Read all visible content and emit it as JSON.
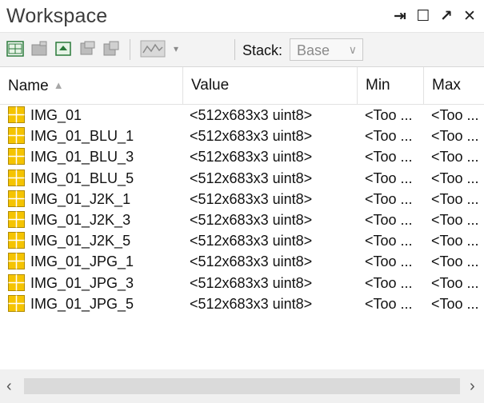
{
  "window": {
    "title": "Workspace",
    "controls": {
      "pin": "⇥",
      "maximize": "☐",
      "undock": "↗",
      "close": "✕"
    }
  },
  "toolbar": {
    "stack_label": "Stack:",
    "stack_value": "Base",
    "dropdown_arrow": "▾",
    "select_arrow": "∨"
  },
  "columns": {
    "name": "Name",
    "value": "Value",
    "min": "Min",
    "max": "Max",
    "sort_indicator": "▲"
  },
  "variables": [
    {
      "name": "IMG_01",
      "value": "<512x683x3 uint8>",
      "min": "<Too ...",
      "max": "<Too ..."
    },
    {
      "name": "IMG_01_BLU_1",
      "value": "<512x683x3 uint8>",
      "min": "<Too ...",
      "max": "<Too ..."
    },
    {
      "name": "IMG_01_BLU_3",
      "value": "<512x683x3 uint8>",
      "min": "<Too ...",
      "max": "<Too ..."
    },
    {
      "name": "IMG_01_BLU_5",
      "value": "<512x683x3 uint8>",
      "min": "<Too ...",
      "max": "<Too ..."
    },
    {
      "name": "IMG_01_J2K_1",
      "value": "<512x683x3 uint8>",
      "min": "<Too ...",
      "max": "<Too ..."
    },
    {
      "name": "IMG_01_J2K_3",
      "value": "<512x683x3 uint8>",
      "min": "<Too ...",
      "max": "<Too ..."
    },
    {
      "name": "IMG_01_J2K_5",
      "value": "<512x683x3 uint8>",
      "min": "<Too ...",
      "max": "<Too ..."
    },
    {
      "name": "IMG_01_JPG_1",
      "value": "<512x683x3 uint8>",
      "min": "<Too ...",
      "max": "<Too ..."
    },
    {
      "name": "IMG_01_JPG_3",
      "value": "<512x683x3 uint8>",
      "min": "<Too ...",
      "max": "<Too ..."
    },
    {
      "name": "IMG_01_JPG_5",
      "value": "<512x683x3 uint8>",
      "min": "<Too ...",
      "max": "<Too ..."
    }
  ],
  "scrollbar": {
    "left_arrow": "‹",
    "right_arrow": "›"
  },
  "colors": {
    "matrix_icon_fill": "#f5c400",
    "matrix_icon_border": "#b08a00"
  }
}
